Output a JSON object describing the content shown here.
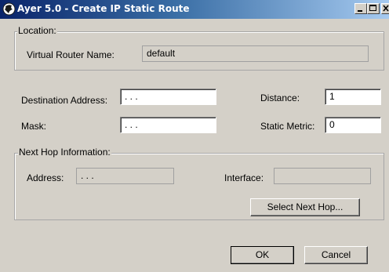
{
  "window": {
    "title": "Ayer 5.0 - Create IP Static Route",
    "icons": {
      "app": "globe-icon",
      "minimize": "minimize-icon",
      "maximize": "maximize-icon",
      "close": "close-icon"
    }
  },
  "location": {
    "legend": "Location:",
    "virtual_router_label": "Virtual Router Name:",
    "virtual_router_value": "default"
  },
  "route": {
    "destination_label": "Destination Address:",
    "destination_value": " .  .  .",
    "mask_label": "Mask:",
    "mask_value": " .  .  .",
    "distance_label": "Distance:",
    "distance_value": "1",
    "metric_label": "Static Metric:",
    "metric_value": "0"
  },
  "next_hop": {
    "legend": "Next Hop Information:",
    "address_label": "Address:",
    "address_value": " .  .  .",
    "interface_label": "Interface:",
    "interface_value": "",
    "select_button": "Select Next Hop..."
  },
  "footer": {
    "ok": "OK",
    "cancel": "Cancel"
  }
}
